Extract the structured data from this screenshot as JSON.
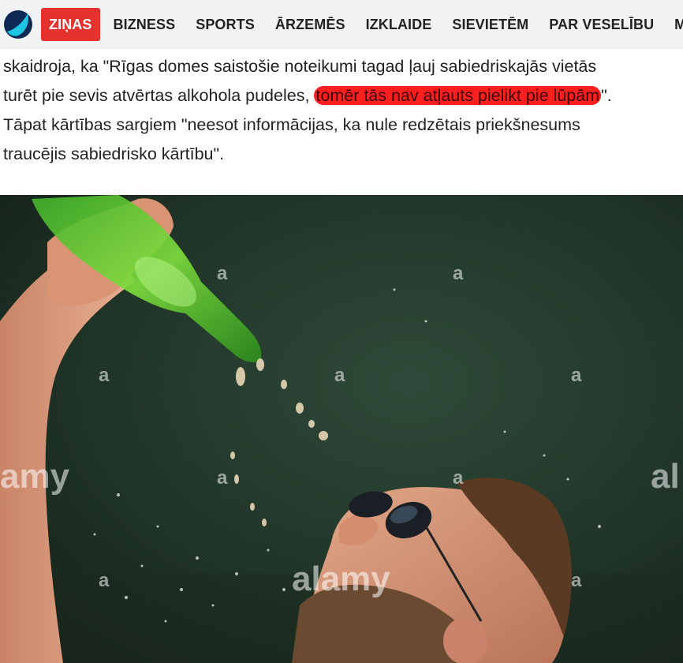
{
  "nav": {
    "items": [
      {
        "label": "ZIŅAS",
        "active": true
      },
      {
        "label": "BIZNESS",
        "active": false
      },
      {
        "label": "SPORTS",
        "active": false
      },
      {
        "label": "ĀRZEMĒS",
        "active": false
      },
      {
        "label": "IZKLAIDE",
        "active": false
      },
      {
        "label": "SIEVIETĒM",
        "active": false
      },
      {
        "label": "PAR VESELĪBU",
        "active": false
      },
      {
        "label": "MĀ",
        "active": false
      }
    ]
  },
  "article": {
    "line1": "skaidroja, ka \"Rīgas domes saistošie noteikumi tagad ļauj sabiedriskajās vietās",
    "line2_pre": "turēt pie sevis atvērtas alkohola pudeles, ",
    "line2_highlight": "tomēr tās nav atļauts pielikt pie lūpām",
    "line2_post": "\".",
    "line3": "Tāpat kārtības sargiem \"neesot informācijas, ka nule redzētais priekšnesums",
    "line4": "traucējis sabiedrisko kārtību\"."
  },
  "photo": {
    "watermark_small": "a",
    "watermark_large": "alamy",
    "watermark_left": "amy",
    "watermark_right": "al"
  },
  "colors": {
    "brand_red": "#e5322f",
    "highlight": "#ff1f1f",
    "nav_bg": "#f1f2f4"
  }
}
